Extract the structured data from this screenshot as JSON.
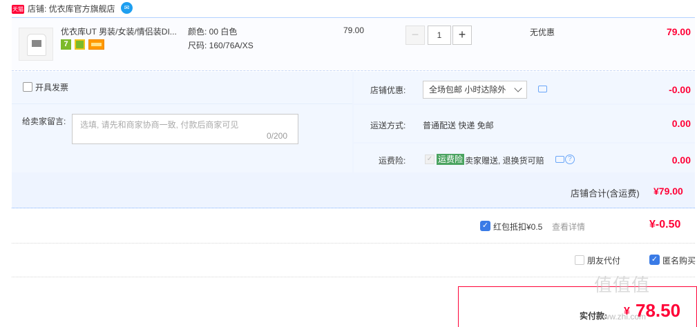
{
  "shop": {
    "badge": "天猫",
    "name": "店铺: 优衣库官方旗舰店",
    "im_icon": "wangwang-chat-icon"
  },
  "item": {
    "title": "优衣库UT 男装/女装/情侣装DI...",
    "color": "颜色: 00 白色",
    "size": "尺码: 160/76A/XS",
    "unit_price": "79.00",
    "quantity": "1",
    "qty_minus": "−",
    "qty_plus": "+",
    "discount": "无优惠",
    "total": "79.00",
    "service_icons": [
      "7-day-return-icon",
      "consumer-protection-icon",
      "credit-card-icon"
    ],
    "service_badge_7": "7"
  },
  "invoice": {
    "label": "开具发票"
  },
  "message": {
    "label": "给卖家留言:",
    "placeholder": "选填, 请先和商家协商一致, 付款后商家可见",
    "counter": "0/200"
  },
  "shop_discount": {
    "label": "店铺优惠:",
    "selected": "全场包邮 小时达除外",
    "value": "-0.00"
  },
  "shipping": {
    "label": "运送方式:",
    "value": "普通配送 快递 免邮",
    "price": "0.00"
  },
  "insurance": {
    "label": "运费险:",
    "badge": "运费险",
    "text": "卖家赠送, 退换货可赔",
    "price": "0.00"
  },
  "shop_total": {
    "label": "店铺合计(含运费)",
    "value": "¥79.00"
  },
  "red_packet": {
    "label": "红包抵扣¥0.5",
    "detail": "查看详情",
    "value": "¥-0.50"
  },
  "friend_pay": {
    "label": "朋友代付"
  },
  "anonymous": {
    "label": "匿名购买"
  },
  "pay": {
    "label": "实付款:",
    "currency": "¥",
    "amount": "78.50"
  },
  "watermark": {
    "text": "值值值",
    "sub": "www.zhi.com"
  },
  "colors": {
    "accent_red": "#ff0036",
    "accent_blue": "#3a7be6",
    "panel_bg": "#f2f7ff"
  }
}
